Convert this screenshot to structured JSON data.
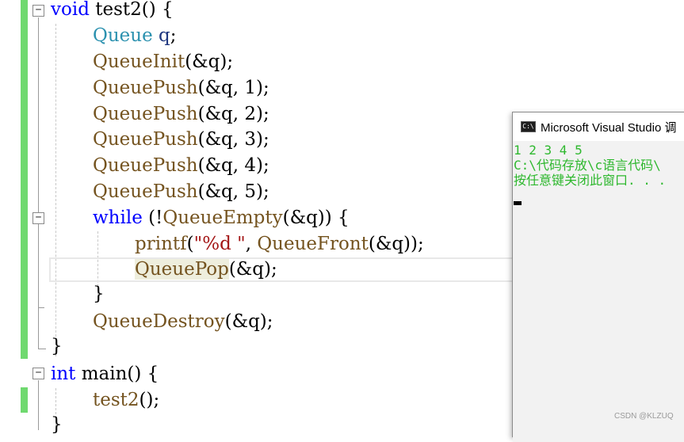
{
  "editor": {
    "lines": [
      {
        "kw": "void",
        "rest": " test2() {"
      },
      {
        "ty": "Queue",
        "var": " q",
        "rest": ";"
      },
      {
        "fn": "QueueInit",
        "rest": "(&q);"
      },
      {
        "fn": "QueuePush",
        "rest": "(&q, 1);"
      },
      {
        "fn": "QueuePush",
        "rest": "(&q, 2);"
      },
      {
        "fn": "QueuePush",
        "rest": "(&q, 3);"
      },
      {
        "fn": "QueuePush",
        "rest": "(&q, 4);"
      },
      {
        "fn": "QueuePush",
        "rest": "(&q, 5);"
      },
      {
        "kw": "while",
        "pre": " (!",
        "fn": "QueueEmpty",
        "rest": "(&q)) {"
      },
      {
        "fn": "printf",
        "str": "\"%d \"",
        "pre": ", ",
        "fn2": "QueueFront",
        "rest": "(&q));"
      },
      {
        "fn": "QueuePop",
        "rest": "(&q);"
      },
      {
        "rest": "}"
      },
      {
        "fn": "QueueDestroy",
        "rest": "(&q);"
      },
      {
        "rest": "}"
      },
      {
        "kw": "int",
        "rest": " main() {"
      },
      {
        "fn": "test2",
        "rest": "();"
      },
      {
        "rest": "}"
      }
    ],
    "fold_symbol": "−"
  },
  "console": {
    "icon_text": "C:\\",
    "title": "Microsoft Visual Studio 调",
    "output": [
      "1 2 3 4 5",
      "C:\\代码存放\\c语言代码\\",
      "按任意键关闭此窗口. . ."
    ],
    "text_color": "#2eb82e"
  },
  "watermark": "CSDN @KLZUQ"
}
